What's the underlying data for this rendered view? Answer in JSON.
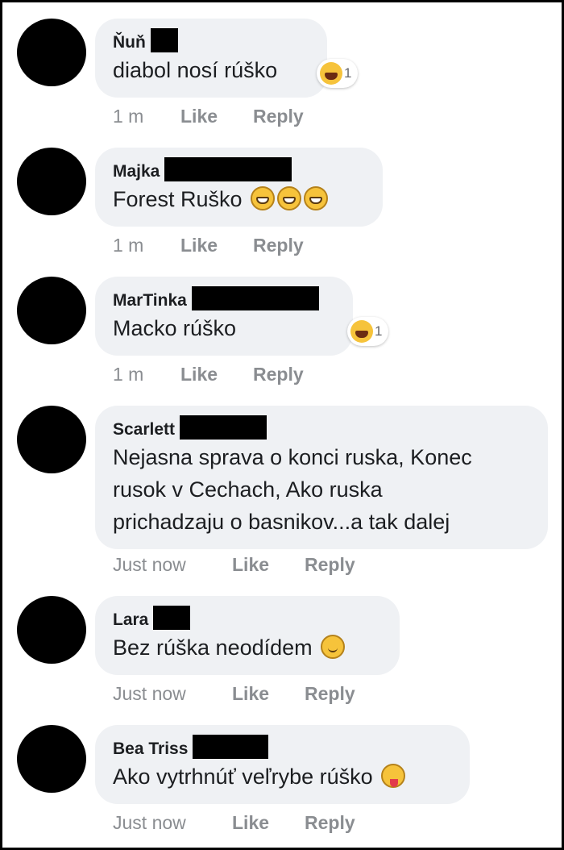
{
  "comments": [
    {
      "name": "Ňuň",
      "text": "diabol nosí rúško",
      "time": "1 m",
      "like": "Like",
      "reply": "Reply",
      "reaction_count": "1",
      "reaction_icon": "laughing-emoji-icon"
    },
    {
      "name": "Majka",
      "text": "Forest Ruško",
      "time": "1 m",
      "like": "Like",
      "reply": "Reply",
      "emoji": "grinning-emoji-icon"
    },
    {
      "name": "MarTinka",
      "text": "Macko rúško",
      "time": "1 m",
      "like": "Like",
      "reply": "Reply",
      "reaction_count": "1",
      "reaction_icon": "laughing-emoji-icon"
    },
    {
      "name": "Scarlett",
      "text_lines": [
        "Nejasna sprava o konci ruska, Konec",
        "rusok v Cechach, Ako ruska",
        "prichadzaju o basnikov...a tak dalej"
      ],
      "time": "Just now",
      "like": "Like",
      "reply": "Reply"
    },
    {
      "name": "Lara",
      "text": "Bez rúška neodídem",
      "time": "Just now",
      "like": "Like",
      "reply": "Reply",
      "emoji": "smiling-emoji-icon"
    },
    {
      "name": "Bea Triss",
      "text": "Ako vytrhnúť veľrybe rúško",
      "time": "Just now",
      "like": "Like",
      "reply": "Reply",
      "emoji": "winking-tongue-emoji-icon"
    }
  ],
  "colors": {
    "bubble": "#eff1f4",
    "meta_text": "#8a8d91",
    "redaction": "#000000"
  }
}
